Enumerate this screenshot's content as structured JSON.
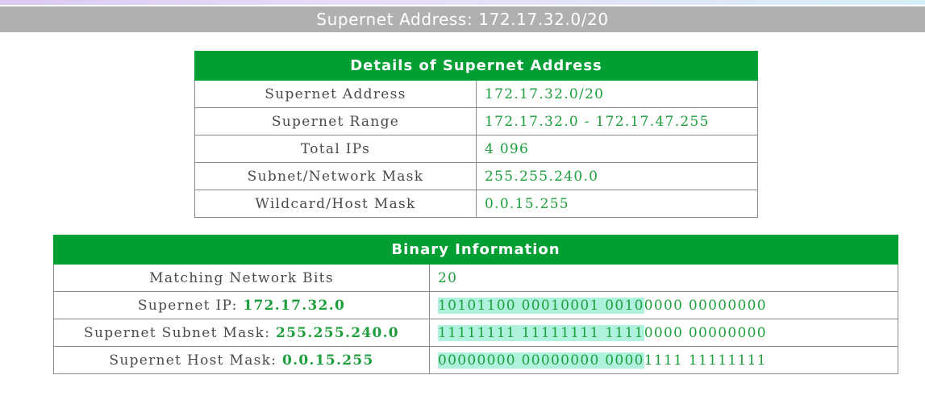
{
  "title": "Supernet Address: 172.17.32.0/20",
  "details": {
    "header": "Details of Supernet Address",
    "rows": [
      {
        "label": "Supernet Address",
        "value": "172.17.32.0/20"
      },
      {
        "label": "Supernet Range",
        "value": "172.17.32.0 - 172.17.47.255"
      },
      {
        "label": "Total IPs",
        "value": "4 096"
      },
      {
        "label": "Subnet/Network Mask",
        "value": "255.255.240.0"
      },
      {
        "label": "Wildcard/Host Mask",
        "value": "0.0.15.255"
      }
    ]
  },
  "binary": {
    "header": "Binary Information",
    "matching_bits": {
      "label": "Matching Network Bits",
      "value": "20"
    },
    "ip": {
      "label": "Supernet IP: ",
      "label_value": "172.17.32.0",
      "bin_highlight": "10101100 00010001 0010",
      "bin_rest": "0000 00000000"
    },
    "mask": {
      "label": "Supernet Subnet Mask: ",
      "label_value": "255.255.240.0",
      "bin_highlight": "11111111 11111111 1111",
      "bin_rest": "0000 00000000"
    },
    "host": {
      "label": "Supernet Host Mask: ",
      "label_value": "0.0.15.255",
      "bin_highlight": "00000000 00000000 0000",
      "bin_rest": "1111 11111111"
    }
  },
  "colors": {
    "header_green": "#009f34",
    "value_green": "#1e9e3c",
    "title_bar_gray": "#b0b0b0",
    "highlight": "#aef2dd"
  }
}
